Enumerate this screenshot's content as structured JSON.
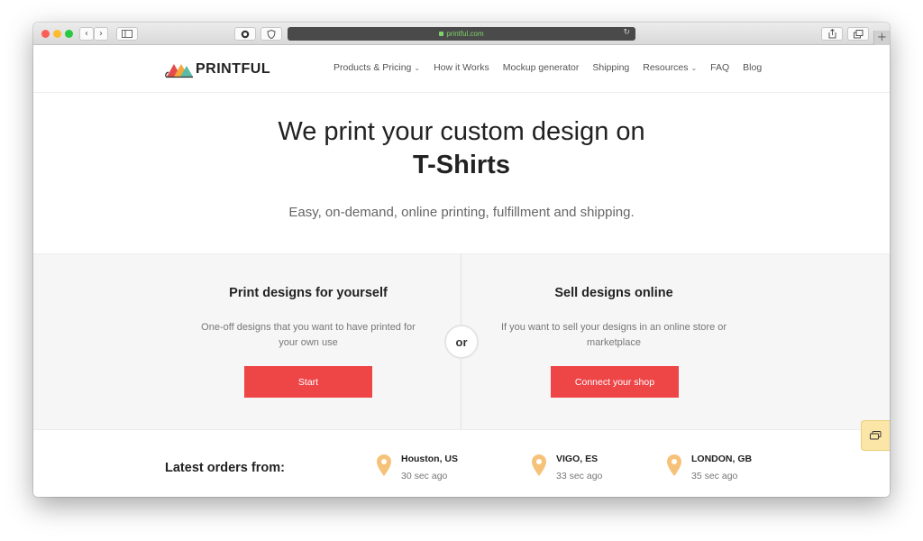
{
  "browser": {
    "url": "printful.com",
    "reload_icon": "reload-icon",
    "new_tab_label": "+"
  },
  "header": {
    "logo_text": "PRINTFUL",
    "nav": [
      {
        "label": "Products & Pricing",
        "dropdown": true
      },
      {
        "label": "How it Works",
        "dropdown": false
      },
      {
        "label": "Mockup generator",
        "dropdown": false
      },
      {
        "label": "Shipping",
        "dropdown": false
      },
      {
        "label": "Resources",
        "dropdown": true
      },
      {
        "label": "FAQ",
        "dropdown": false
      },
      {
        "label": "Blog",
        "dropdown": false
      }
    ]
  },
  "hero": {
    "title": "We print your custom design on",
    "highlight": "T-Shirts",
    "subtitle": "Easy, on-demand, online printing, fulfillment and shipping."
  },
  "options": {
    "left": {
      "title": "Print designs for yourself",
      "description": "One-off designs that you want to have printed for your own use",
      "button": "Start"
    },
    "divider": "or",
    "right": {
      "title": "Sell designs online",
      "description": "If you want to sell your designs in an online store or marketplace",
      "button": "Connect your shop"
    }
  },
  "orders": {
    "label": "Latest orders from:",
    "items": [
      {
        "city": "Houston, US",
        "time": "30 sec ago"
      },
      {
        "city": "VIGO, ES",
        "time": "33 sec ago"
      },
      {
        "city": "LONDON, GB",
        "time": "35 sec ago"
      }
    ]
  },
  "colors": {
    "accent": "#ee4547",
    "pin": "#f6c27a",
    "chat": "#fbe6a7"
  }
}
